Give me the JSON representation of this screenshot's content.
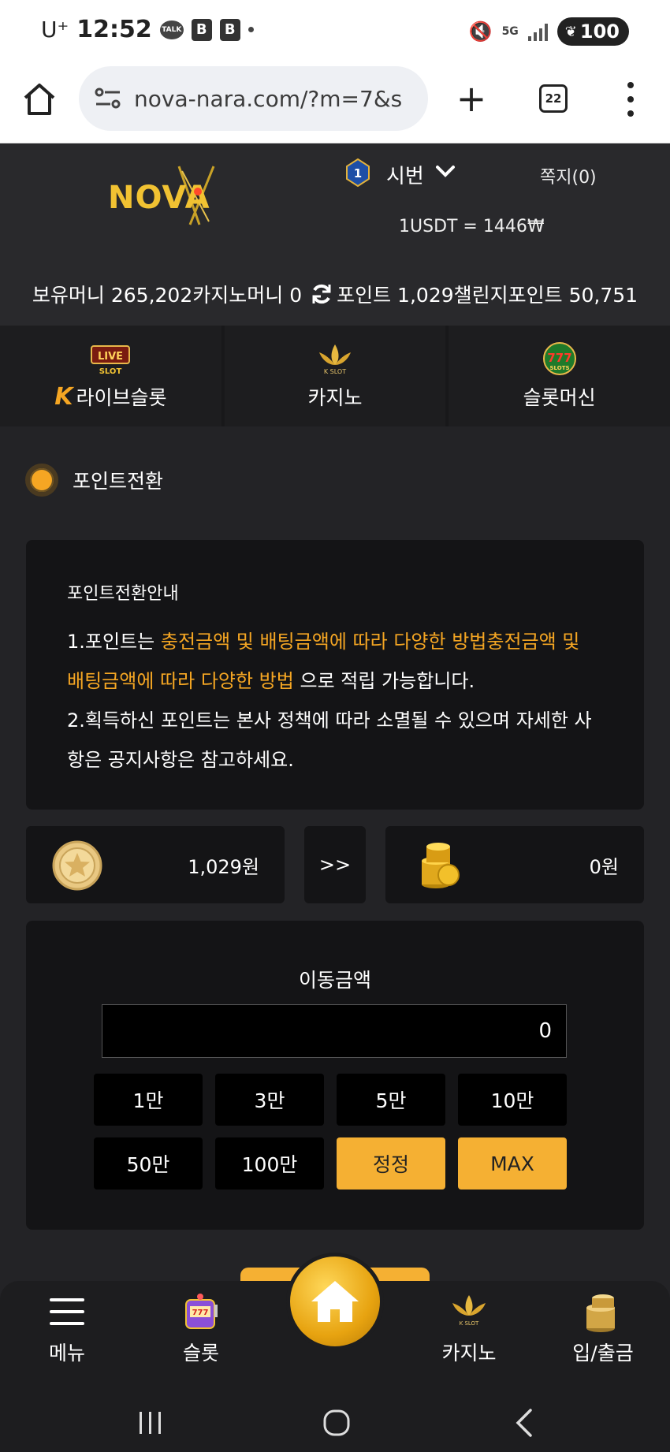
{
  "status_bar": {
    "carrier": "U⁺",
    "time": "12:52",
    "talk": "TALK",
    "b1": "B",
    "b2": "B",
    "network": "5G",
    "battery": "100"
  },
  "browser": {
    "url": "nova-nara.com/?m=7&s",
    "tab_count": "22"
  },
  "header": {
    "logo_text": "NOVA",
    "level": "1",
    "username": "시번",
    "messages": "쪽지(0)",
    "rate": "1USDT = 1446₩",
    "holding": "보유머니 265,202",
    "casino_money": "카지노머니 0",
    "points": "포인트 1,029",
    "challenge_points": "챌린지포인트 50,751"
  },
  "game_tabs": [
    {
      "label": "라이브슬롯",
      "icon": "live-slot-icon",
      "prefix": "K"
    },
    {
      "label": "카지노",
      "icon": "kslot-lotus-icon"
    },
    {
      "label": "슬롯머신",
      "icon": "777-slots-icon"
    }
  ],
  "section_title": "포인트전환",
  "info": {
    "title": "포인트전환안내",
    "line1_prefix": "1.포인트는 ",
    "line1_highlight": "충전금액 및 배팅금액에 따라 다양한 방법충전금액 및 배팅금액에 따라 다양한 방법",
    "line1_suffix": " 으로 적립 가능합니다.",
    "line2": "2.획득하신 포인트는 본사 정책에 따라 소멸될 수 있으며 자세한 사항은 공지사항은 참고하세요."
  },
  "conversion": {
    "point_value": "1,029원",
    "arrow": ">>",
    "target_value": "0원"
  },
  "amount_panel": {
    "title": "이동금액",
    "input_value": "0",
    "buttons": [
      "1만",
      "3만",
      "5만",
      "10만",
      "50만",
      "100만"
    ],
    "reset": "정정",
    "max": "MAX"
  },
  "bottom_nav": {
    "menu": "메뉴",
    "slot": "슬롯",
    "casino": "카지노",
    "deposit": "입/출금"
  },
  "colors": {
    "accent": "#f5a623",
    "button_gold": "#f5b033",
    "bg": "#232326",
    "panel": "#141416"
  }
}
